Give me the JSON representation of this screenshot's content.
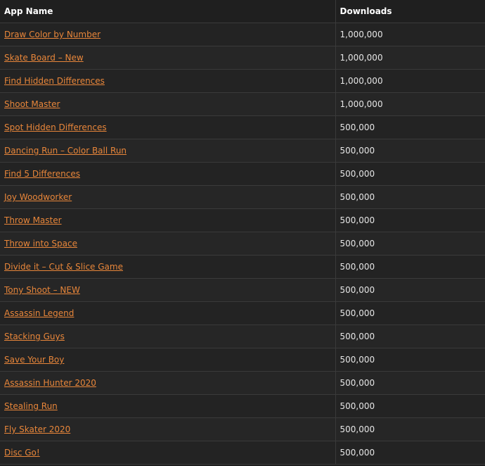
{
  "table": {
    "headers": {
      "app_name": "App Name",
      "downloads": "Downloads"
    },
    "rows": [
      {
        "name": "Draw Color by Number",
        "downloads": "1,000,000"
      },
      {
        "name": "Skate Board – New",
        "downloads": "1,000,000"
      },
      {
        "name": "Find Hidden Differences",
        "downloads": "1,000,000"
      },
      {
        "name": "Shoot Master",
        "downloads": "1,000,000"
      },
      {
        "name": "Spot Hidden Differences",
        "downloads": "500,000"
      },
      {
        "name": "Dancing Run – Color Ball Run",
        "downloads": "500,000"
      },
      {
        "name": "Find 5 Differences",
        "downloads": "500,000"
      },
      {
        "name": "Joy Woodworker",
        "downloads": "500,000"
      },
      {
        "name": "Throw Master",
        "downloads": "500,000"
      },
      {
        "name": "Throw into Space",
        "downloads": "500,000"
      },
      {
        "name": "Divide it – Cut & Slice Game",
        "downloads": "500,000"
      },
      {
        "name": "Tony Shoot – NEW",
        "downloads": "500,000"
      },
      {
        "name": "Assassin Legend",
        "downloads": "500,000"
      },
      {
        "name": "Stacking Guys",
        "downloads": "500,000"
      },
      {
        "name": "Save Your Boy",
        "downloads": "500,000"
      },
      {
        "name": "Assassin Hunter 2020",
        "downloads": "500,000"
      },
      {
        "name": "Stealing Run",
        "downloads": "500,000"
      },
      {
        "name": "Fly Skater 2020",
        "downloads": "500,000"
      },
      {
        "name": "Disc Go!",
        "downloads": "500,000"
      }
    ]
  },
  "colors": {
    "background": "#1f1f1f",
    "link": "#e8863a",
    "text": "#e6e6e6",
    "border": "#3a3a3a"
  }
}
